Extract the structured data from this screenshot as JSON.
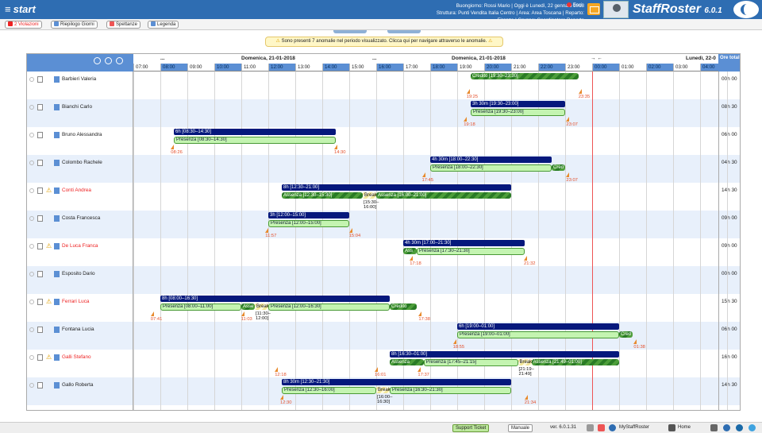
{
  "app": {
    "start_label": "start",
    "greeting": "Buongiorno: Rossi Mario | Oggi è Lunedì, 22 gennaio 2018",
    "structure": "Struttura: Punti Vendita Italia Centro | Area: Area Toscana | Reparto: Firenze | Gruppo: Coordinatore Reparto",
    "exit_label": "Esci",
    "brand": "StaffRoster",
    "version_badge": "6.0.1"
  },
  "toolbar": {
    "violations": "2 Violazioni",
    "summary": "Riepilogo Giorni",
    "spettanze": "Spettanze",
    "legend": "Legenda"
  },
  "alert": {
    "text": "Sono presenti 7 anomalie nel periodo visualizzato. Clicca qui per navigare attraverso le anomalie."
  },
  "header": {
    "date_left": "Domenica, 21-01-2018",
    "date_mid": "Domenica, 21-01-2018",
    "date_right": "Lunedì, 22-0",
    "ellipsis": "...",
    "ore_total": "Ore total",
    "hours": [
      "07:00",
      "08:00",
      "09:00",
      "10:00",
      "11:00",
      "12:00",
      "13:00",
      "14:00",
      "15:00",
      "16:00",
      "17:00",
      "18:00",
      "19:00",
      "20:00",
      "21:00",
      "22:00",
      "23:00",
      "00:00",
      "01:00",
      "02:00",
      "03:00",
      "04:00"
    ]
  },
  "rows": [
    {
      "name": "Barbieri Valeria",
      "red": false,
      "warn": false,
      "total": "00h 00"
    },
    {
      "name": "Bianchi Carlo",
      "red": false,
      "warn": false,
      "total": "08h 30"
    },
    {
      "name": "Bruno Alessandra",
      "red": false,
      "warn": false,
      "total": "06h 00"
    },
    {
      "name": "Colombo Rachele",
      "red": false,
      "warn": false,
      "total": "04h 30"
    },
    {
      "name": "Conti Andrea",
      "red": true,
      "warn": true,
      "total": "14h 30"
    },
    {
      "name": "Costa Francesca",
      "red": false,
      "warn": false,
      "total": "09h 00"
    },
    {
      "name": "De Luca Franca",
      "red": true,
      "warn": true,
      "total": "09h 00"
    },
    {
      "name": "Esposito Dario",
      "red": false,
      "warn": false,
      "total": "00h 00"
    },
    {
      "name": "Ferrari Luca",
      "red": true,
      "warn": true,
      "total": "15h 30"
    },
    {
      "name": "Fontana Lucia",
      "red": false,
      "warn": false,
      "total": "06h 00"
    },
    {
      "name": "Galli Stefano",
      "red": true,
      "warn": true,
      "total": "16h 00"
    },
    {
      "name": "Gallo Roberta",
      "red": false,
      "warn": false,
      "total": "14h 30"
    },
    {
      "name": "",
      "red": false,
      "warn": false,
      "total": "00h 00"
    }
  ],
  "bars": [
    {
      "row": 0,
      "kind": "hatch",
      "start": 19.5,
      "end": 23.5,
      "label": "Credito [19:30–23:30]",
      "lane": 0
    },
    {
      "row": 1,
      "kind": "plan",
      "start": 19.5,
      "end": 23.0,
      "label": "3h 30m [19:30–23:00]",
      "lane": 0
    },
    {
      "row": 1,
      "kind": "pres",
      "start": 19.5,
      "end": 23.0,
      "label": "Presenza [19:30–23:00]",
      "lane": 1
    },
    {
      "row": 2,
      "kind": "plan",
      "start": 8.5,
      "end": 14.5,
      "label": "6h [08:30–14:30]",
      "lane": 0
    },
    {
      "row": 2,
      "kind": "pres",
      "start": 8.5,
      "end": 14.5,
      "label": "Presenza [08:30–14:30]",
      "lane": 1
    },
    {
      "row": 3,
      "kind": "plan",
      "start": 18.0,
      "end": 22.5,
      "label": "4h 30m [18:00–22:30]",
      "lane": 0
    },
    {
      "row": 3,
      "kind": "pres",
      "start": 18.0,
      "end": 22.5,
      "label": "Presenza [18:00–22:30]",
      "lane": 1
    },
    {
      "row": 3,
      "kind": "hatch",
      "start": 22.5,
      "end": 23.0,
      "label": "Cred",
      "lane": 1
    },
    {
      "row": 4,
      "kind": "plan",
      "start": 12.5,
      "end": 21.0,
      "label": "8h [12:30–21:00]",
      "lane": 0
    },
    {
      "row": 4,
      "kind": "hatch",
      "start": 12.5,
      "end": 15.5,
      "label": "Assenza [12:30–15:30]",
      "lane": 1
    },
    {
      "row": 4,
      "kind": "brk",
      "start": 15.5,
      "end": 16.0,
      "label": "Break",
      "lane": 1
    },
    {
      "row": 4,
      "kind": "hatch",
      "start": 16.0,
      "end": 21.0,
      "label": "Assenza [16:00–21:00]",
      "lane": 1
    },
    {
      "row": 5,
      "kind": "plan",
      "start": 12.0,
      "end": 15.0,
      "label": "3h [12:00–15:00]",
      "lane": 0
    },
    {
      "row": 5,
      "kind": "pres",
      "start": 12.0,
      "end": 15.0,
      "label": "Presenza [12:00–15:00]",
      "lane": 1
    },
    {
      "row": 6,
      "kind": "plan",
      "start": 17.0,
      "end": 21.5,
      "label": "4h 30m [17:00–21:30]",
      "lane": 0
    },
    {
      "row": 6,
      "kind": "hatch",
      "start": 17.0,
      "end": 17.5,
      "label": "Ass",
      "lane": 1
    },
    {
      "row": 6,
      "kind": "pres",
      "start": 17.5,
      "end": 21.5,
      "label": "Presenza [17:30–21:30]",
      "lane": 1
    },
    {
      "row": 8,
      "kind": "plan",
      "start": 8.0,
      "end": 16.5,
      "label": "8h [08:00–16:30]",
      "lane": 0
    },
    {
      "row": 8,
      "kind": "pres",
      "start": 8.0,
      "end": 11.0,
      "label": "Presenza [08:00–11:00]",
      "lane": 1
    },
    {
      "row": 8,
      "kind": "hatch",
      "start": 11.0,
      "end": 11.5,
      "label": "Asse",
      "lane": 1
    },
    {
      "row": 8,
      "kind": "brk",
      "start": 11.5,
      "end": 12.0,
      "label": "Break",
      "lane": 1
    },
    {
      "row": 8,
      "kind": "pres",
      "start": 12.0,
      "end": 16.5,
      "label": "Presenza [12:00–16:30]",
      "lane": 1
    },
    {
      "row": 8,
      "kind": "hatch",
      "start": 16.5,
      "end": 17.5,
      "label": "Credito",
      "lane": 1
    },
    {
      "row": 9,
      "kind": "plan",
      "start": 19.0,
      "end": 25.0,
      "label": "6h [19:00–01:00]",
      "lane": 0
    },
    {
      "row": 9,
      "kind": "pres",
      "start": 19.0,
      "end": 25.0,
      "label": "Presenza [19:00–01:00]",
      "lane": 1
    },
    {
      "row": 9,
      "kind": "hatch",
      "start": 25.0,
      "end": 25.5,
      "label": "Cred",
      "lane": 1
    },
    {
      "row": 10,
      "kind": "plan",
      "start": 16.5,
      "end": 25.0,
      "label": "8h [16:30–01:00]",
      "lane": 0
    },
    {
      "row": 10,
      "kind": "hatch",
      "start": 16.5,
      "end": 17.75,
      "label": "Assenza",
      "lane": 1
    },
    {
      "row": 10,
      "kind": "pres",
      "start": 17.75,
      "end": 21.25,
      "label": "Presenza [17:45–21:15]",
      "lane": 1
    },
    {
      "row": 10,
      "kind": "brk",
      "start": 21.25,
      "end": 21.75,
      "label": "Break",
      "lane": 1
    },
    {
      "row": 10,
      "kind": "hatch",
      "start": 21.75,
      "end": 25.0,
      "label": "Assenza [21:49–01:00]",
      "lane": 1
    },
    {
      "row": 11,
      "kind": "plan",
      "start": 12.5,
      "end": 21.0,
      "label": "8h 30m [12:30–21:30]",
      "lane": 0
    },
    {
      "row": 11,
      "kind": "pres",
      "start": 12.5,
      "end": 16.0,
      "label": "Presenza [12:30–16:00]",
      "lane": 1
    },
    {
      "row": 11,
      "kind": "brk",
      "start": 16.0,
      "end": 16.5,
      "label": "Break",
      "lane": 1
    },
    {
      "row": 11,
      "kind": "pres",
      "start": 16.5,
      "end": 21.0,
      "label": "Presenza [16:30–21:30]",
      "lane": 1
    }
  ],
  "marks": [
    {
      "row": 0,
      "t": 19.4,
      "label": "19:25"
    },
    {
      "row": 0,
      "t": 23.55,
      "label": "23:35"
    },
    {
      "row": 1,
      "t": 19.3,
      "label": "19:18"
    },
    {
      "row": 1,
      "t": 23.1,
      "label": "23:07"
    },
    {
      "row": 2,
      "t": 8.45,
      "label": "08:26"
    },
    {
      "row": 2,
      "t": 14.5,
      "label": "14:30"
    },
    {
      "row": 3,
      "t": 17.75,
      "label": "17:45"
    },
    {
      "row": 3,
      "t": 23.1,
      "label": "23:07"
    },
    {
      "row": 5,
      "t": 11.95,
      "label": "11:57"
    },
    {
      "row": 5,
      "t": 15.05,
      "label": "15:04"
    },
    {
      "row": 6,
      "t": 17.3,
      "label": "17:18"
    },
    {
      "row": 6,
      "t": 21.53,
      "label": "21:32"
    },
    {
      "row": 8,
      "t": 7.7,
      "label": "07:41"
    },
    {
      "row": 8,
      "t": 11.05,
      "label": "11:03"
    },
    {
      "row": 8,
      "t": 17.63,
      "label": "17:38"
    },
    {
      "row": 9,
      "t": 18.9,
      "label": "18:55"
    },
    {
      "row": 9,
      "t": 25.6,
      "label": "01:38"
    },
    {
      "row": 10,
      "t": 12.3,
      "label": "12:18"
    },
    {
      "row": 10,
      "t": 16.0,
      "label": "16:01"
    },
    {
      "row": 10,
      "t": 17.6,
      "label": "17:37"
    },
    {
      "row": 11,
      "t": 12.5,
      "label": "12:30"
    },
    {
      "row": 11,
      "t": 21.55,
      "label": "21:34"
    }
  ],
  "notes": [
    {
      "row": 4,
      "t": 15.5,
      "lines": [
        "[15:30–",
        "16:00]"
      ]
    },
    {
      "row": 8,
      "t": 11.5,
      "lines": [
        "[11:30–",
        "12:00]"
      ]
    },
    {
      "row": 10,
      "t": 21.25,
      "lines": [
        "[21:19–",
        "21:49]"
      ]
    },
    {
      "row": 11,
      "t": 16.0,
      "lines": [
        "[16:00–",
        "16:30]"
      ]
    }
  ],
  "now_hour": 24.0,
  "footer": {
    "support": "Support Ticket",
    "manual": "Manuale",
    "version": "ver. 6.0.1.31",
    "my": "MyStaffRoster",
    "home": "Home"
  },
  "colors": {
    "accent": "#2e6db2",
    "plan": "#05187c",
    "presence": "#c4f4b1",
    "absence": "#2a7b26",
    "violation": "#e22222"
  }
}
